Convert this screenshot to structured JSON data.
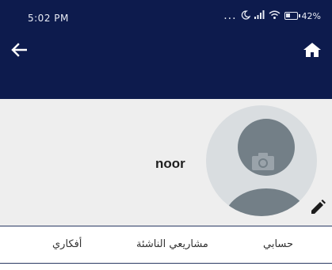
{
  "status_bar": {
    "time": "5:02 PM",
    "indicators": "...",
    "battery": "42%",
    "battery_level": 0.42
  },
  "toolbar": {
    "back_icon": "arrow-left-icon",
    "home_icon": "home-icon"
  },
  "profile": {
    "username": "noor",
    "avatar_icon": "camera-icon",
    "edit_icon": "pencil-icon"
  },
  "tabs": [
    {
      "label": "حسابي"
    },
    {
      "label": "مشاريعي الناشئة"
    },
    {
      "label": "أفكاري"
    }
  ],
  "colors": {
    "header": "#0d1b4d",
    "profile_bg": "#eeeeee",
    "avatar_bg": "#d9dde0",
    "avatar_fg": "#737f87"
  }
}
